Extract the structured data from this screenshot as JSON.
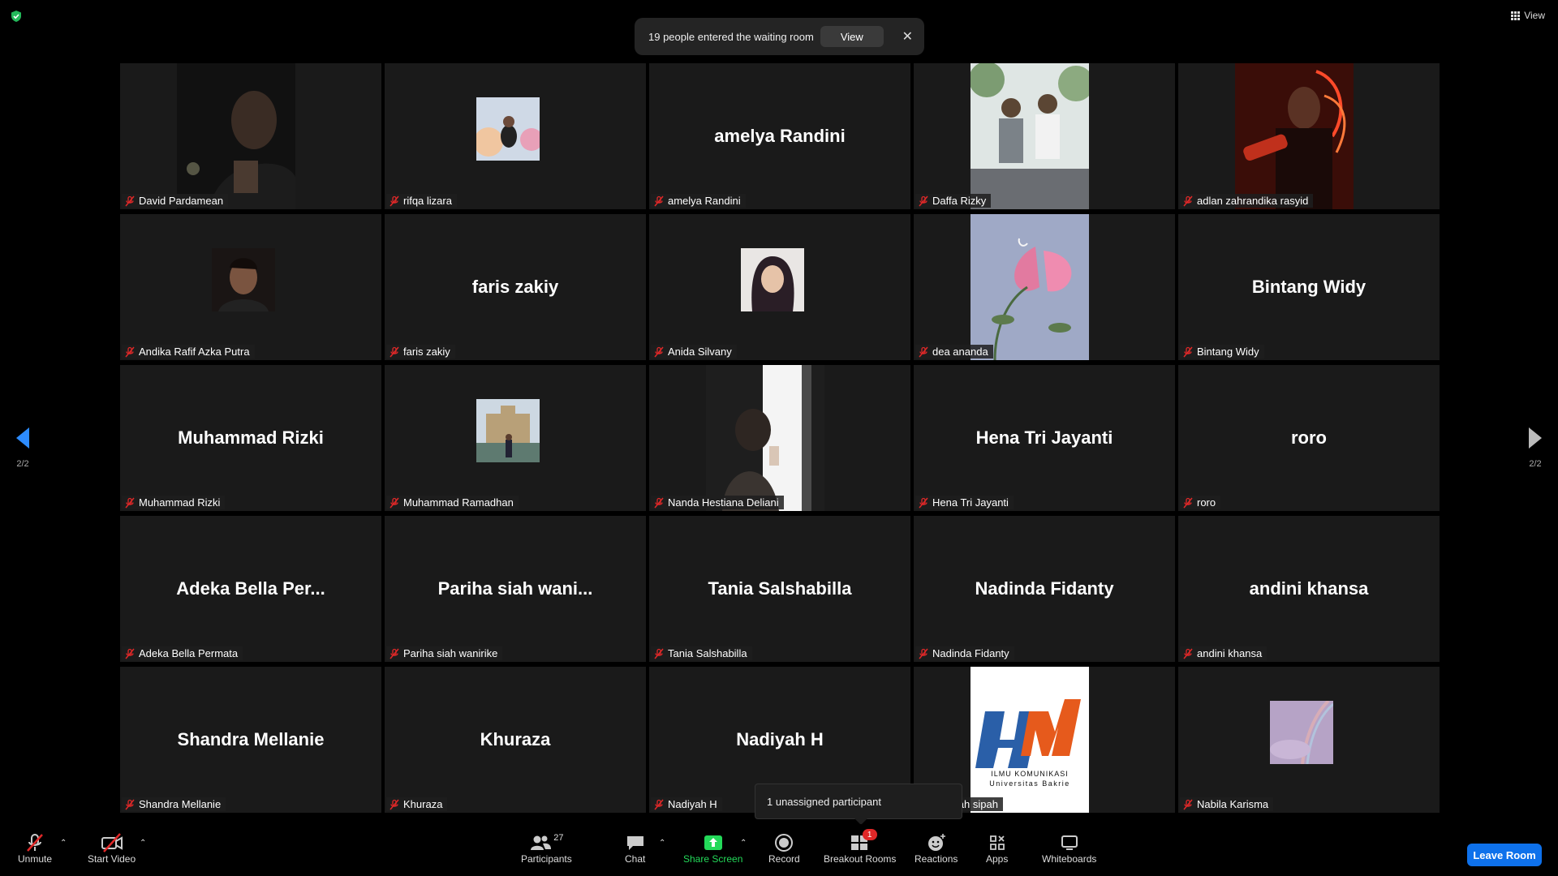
{
  "top": {
    "view_label": "View"
  },
  "notification": {
    "text": "19 people entered the waiting room",
    "button": "View",
    "close": "✕"
  },
  "pager": {
    "left": "2/2",
    "right": "2/2"
  },
  "tiles": [
    {
      "name": "David Pardamean",
      "display": "",
      "media": "photo-dark"
    },
    {
      "name": "rifqa lizara",
      "display": "",
      "media": "photo-balloons"
    },
    {
      "name": "amelya Randini",
      "display": "amelya Randini",
      "media": ""
    },
    {
      "name": "Daffa Rizky",
      "display": "",
      "media": "photo-garden"
    },
    {
      "name": "adlan zahrandika rasyid",
      "display": "",
      "media": "photo-neon"
    },
    {
      "name": "Andika Rafif Azka Putra",
      "display": "",
      "media": "photo-portrait"
    },
    {
      "name": "faris zakiy",
      "display": "faris zakiy",
      "media": ""
    },
    {
      "name": "Anida Silvany",
      "display": "",
      "media": "photo-hijab"
    },
    {
      "name": "dea ananda",
      "display": "",
      "media": "photo-flower"
    },
    {
      "name": "Bintang Widy",
      "display": "Bintang Widy",
      "media": ""
    },
    {
      "name": "Muhammad Rizki",
      "display": "Muhammad Rizki",
      "media": ""
    },
    {
      "name": "Muhammad Ramadhan",
      "display": "",
      "media": "photo-building"
    },
    {
      "name": "Nanda Hestiana Deliani",
      "display": "",
      "media": "photo-window"
    },
    {
      "name": "Hena Tri Jayanti",
      "display": "Hena Tri Jayanti",
      "media": ""
    },
    {
      "name": "roro",
      "display": "roro",
      "media": ""
    },
    {
      "name": "Adeka Bella Permata",
      "display": "Adeka Bella Per...",
      "media": ""
    },
    {
      "name": "Pariha siah wanirike",
      "display": "Pariha siah wani...",
      "media": ""
    },
    {
      "name": "Tania Salshabilla",
      "display": "Tania Salshabilla",
      "media": ""
    },
    {
      "name": "Nadinda Fidanty",
      "display": "Nadinda Fidanty",
      "media": ""
    },
    {
      "name": "andini khansa",
      "display": "andini khansa",
      "media": ""
    },
    {
      "name": "Shandra Mellanie",
      "display": "Shandra Mellanie",
      "media": ""
    },
    {
      "name": "Khuraza",
      "display": "Khuraza",
      "media": ""
    },
    {
      "name": "Nadiyah H",
      "display": "Nadiyah H",
      "media": ""
    },
    {
      "name": "Sabillah sipah",
      "display": "",
      "media": "logo-hm"
    },
    {
      "name": "Nabila Karisma",
      "display": "",
      "media": "photo-rainbow"
    }
  ],
  "logo": {
    "line1": "ILMU KOMUNIKASI",
    "line2": "Universitas Bakrie"
  },
  "tooltip": "1 unassigned participant",
  "toolbar": {
    "unmute": "Unmute",
    "start_video": "Start Video",
    "participants": "Participants",
    "participants_count": "27",
    "chat": "Chat",
    "share_screen": "Share Screen",
    "record": "Record",
    "breakout_rooms": "Breakout Rooms",
    "breakout_badge": "1",
    "reactions": "Reactions",
    "apps": "Apps",
    "whiteboards": "Whiteboards",
    "leave": "Leave Room"
  },
  "colors": {
    "accent": "#0e71eb",
    "share_green": "#23d959",
    "mute_red": "#e02828",
    "tile_bg": "#1a1a1a"
  }
}
